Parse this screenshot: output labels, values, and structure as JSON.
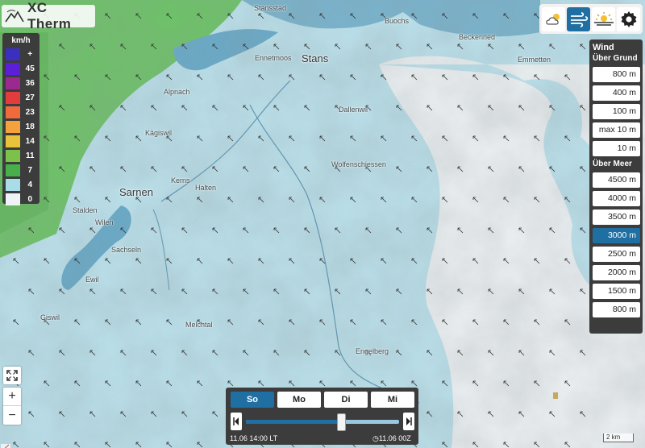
{
  "app": {
    "name": "XC Therm"
  },
  "legend": {
    "unit": "km/h",
    "entries": [
      {
        "label": "+",
        "color": "#3b2fc0"
      },
      {
        "label": "45",
        "color": "#5a1fd6"
      },
      {
        "label": "36",
        "color": "#9a2a8e"
      },
      {
        "label": "27",
        "color": "#e23c3c"
      },
      {
        "label": "23",
        "color": "#f06a3c"
      },
      {
        "label": "18",
        "color": "#f4a23c"
      },
      {
        "label": "14",
        "color": "#e8c23a"
      },
      {
        "label": "11",
        "color": "#7cc24a"
      },
      {
        "label": "7",
        "color": "#48b04a"
      },
      {
        "label": "4",
        "color": "#a8dde8"
      },
      {
        "label": "0",
        "color": "#eef4f6"
      }
    ]
  },
  "layers": [
    {
      "icon": "cloud-sun-icon",
      "active": false
    },
    {
      "icon": "wind-icon",
      "active": true
    },
    {
      "icon": "sun-horizon-icon",
      "active": false
    },
    {
      "icon": "gear-icon",
      "active": false
    }
  ],
  "wind_panel": {
    "title": "Wind",
    "ground_title": "Über Grund",
    "ground_levels": [
      "800 m",
      "400 m",
      "100 m",
      "max 10 m",
      "10 m"
    ],
    "sea_title": "Über Meer",
    "sea_levels": [
      "4500 m",
      "4000 m",
      "3500 m",
      "3000 m",
      "2500 m",
      "2000 m",
      "1500 m",
      "800 m"
    ],
    "selected": "3000 m"
  },
  "time": {
    "days": [
      "So",
      "Mo",
      "Di",
      "Mi"
    ],
    "active_day": "So",
    "position": 0.62,
    "local_time": "11.06 14:00 LT",
    "model_run": "11.06 00Z"
  },
  "map": {
    "places": {
      "stansstad": "Stansstad",
      "buochs": "Buochs",
      "beckenried": "Beckenried",
      "emmetten": "Emmetten",
      "ennetmoos": "Ennetmoos",
      "stans": "Stans",
      "alpnach": "Alpnach",
      "dallenwil": "Dallenwil",
      "kaegiswil": "Kägiswil",
      "wolfenschiessen": "Wolfenschiessen",
      "kerns": "Kerns",
      "halten": "Halten",
      "sarnen": "Sarnen",
      "stalden": "Stalden",
      "wilen": "Wilen",
      "sachseln": "Sachseln",
      "ewil": "Ewil",
      "giswil": "Giswil",
      "melchtal": "Melchtal",
      "engelberg": "Engelberg"
    },
    "scale_label": "2 km"
  }
}
